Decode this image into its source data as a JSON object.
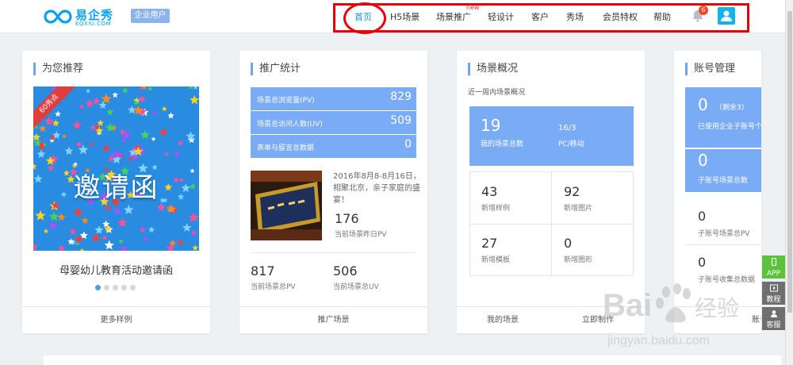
{
  "header": {
    "logo_cn": "易企秀",
    "logo_en": "EQXIU.COM",
    "enterprise_badge": "企业用户",
    "nav": [
      {
        "label": "首页"
      },
      {
        "label": "H5场景"
      },
      {
        "label": "场景推广"
      },
      {
        "label": "轻设计"
      },
      {
        "label": "客户"
      },
      {
        "label": "秀场"
      },
      {
        "label": "会员特权"
      },
      {
        "label": "帮助"
      }
    ],
    "new_tag": "new",
    "notification_count": "6"
  },
  "recommend": {
    "title": "为您推荐",
    "ribbon": "60秀点",
    "image_text": "邀请函",
    "caption": "母婴幼儿教育活动邀请函",
    "footer": "更多样例"
  },
  "stats": {
    "title": "推广统计",
    "rows": [
      {
        "label": "场景总浏览量(PV)",
        "value": "829"
      },
      {
        "label": "场景总访问人数(UV)",
        "value": "509"
      },
      {
        "label": "表单与留言总数据",
        "value": "0"
      }
    ],
    "news_text": "2016年8月8-8月16日，相聚北京，亲子家庭的盛宴！",
    "yesterday_pv": "176",
    "yesterday_pv_label": "当前场景昨日PV",
    "current_pv": "817",
    "current_pv_label": "当前场景总PV",
    "current_uv": "506",
    "current_uv_label": "当前场景总UV",
    "footer": "推广场景"
  },
  "overview": {
    "title": "场景概况",
    "subtitle": "近一周内场景概况",
    "total": "19",
    "total_label": "我的场景总数",
    "pc_mobile": "16/3",
    "pc_mobile_label": "PC/移动",
    "grid": [
      {
        "value": "43",
        "label": "新增样例"
      },
      {
        "value": "92",
        "label": "新增图片"
      },
      {
        "value": "27",
        "label": "新增模板"
      },
      {
        "value": "0",
        "label": "新增图形"
      }
    ],
    "footer_left": "我的场景",
    "footer_right": "立即制作"
  },
  "account": {
    "title": "账号管理",
    "used": "0",
    "remaining": "（剩余3）",
    "used_label": "已使用企业子账号个数",
    "sub_scenes": "0",
    "sub_scenes_label": "子账号场景总数",
    "sub_pv": "0",
    "sub_pv_label": "子账号场景总PV",
    "sub_data": "0",
    "sub_data_label": "子账号收集总数据",
    "footer": "账号"
  },
  "side_tools": [
    {
      "label": "APP"
    },
    {
      "label": "教程"
    },
    {
      "label": "客服"
    }
  ],
  "watermark": {
    "brand": "Bai",
    "brand2": "经验",
    "url": "jingyan.baidu.com"
  }
}
